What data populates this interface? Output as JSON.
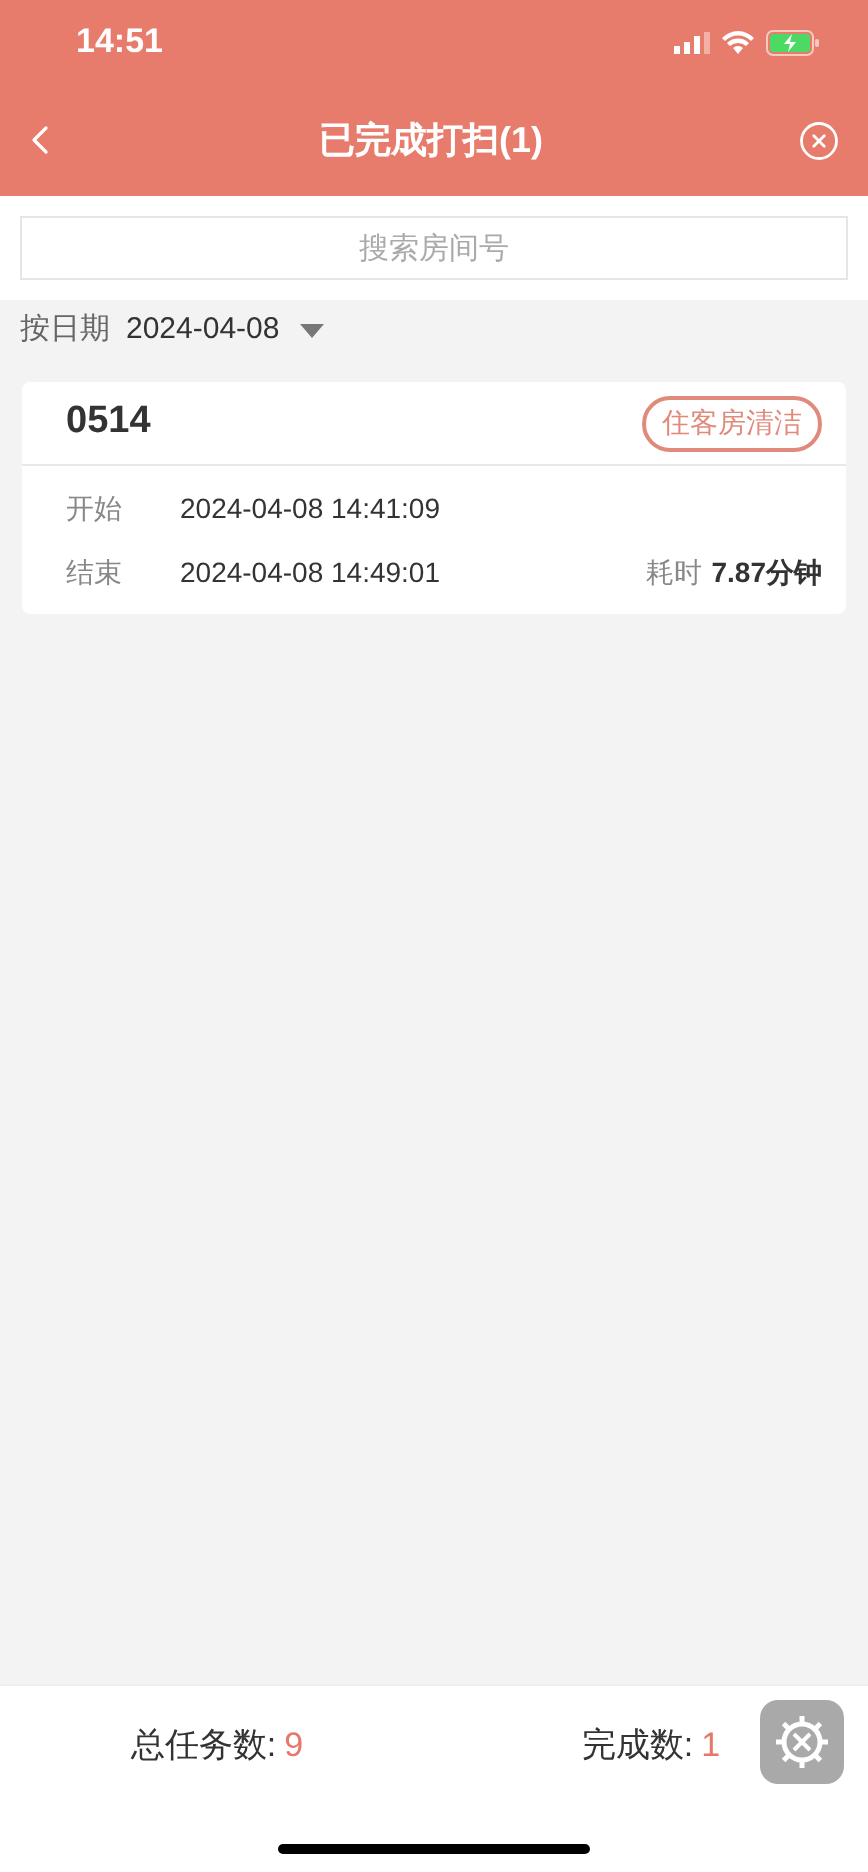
{
  "status_bar": {
    "time": "14:51"
  },
  "nav": {
    "title": "已完成打扫(1)"
  },
  "search": {
    "placeholder": "搜索房间号"
  },
  "filter": {
    "label": "按日期",
    "value": "2024-04-08"
  },
  "records": [
    {
      "room": "0514",
      "tag": "住客房清洁",
      "start_label": "开始",
      "start": "2024-04-08 14:41:09",
      "end_label": "结束",
      "end": "2024-04-08 14:49:01",
      "duration_label": "耗时",
      "duration": "7.87分钟"
    }
  ],
  "footer": {
    "stats": [
      {
        "label": "总任务数:",
        "value": "9"
      },
      {
        "label": "完成数:",
        "value": "1"
      }
    ]
  }
}
